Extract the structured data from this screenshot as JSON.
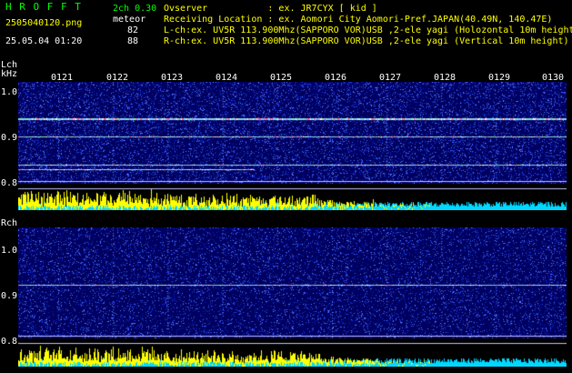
{
  "header": {
    "logo": "H R O F F T",
    "mode": "2ch 0.30",
    "type": "meteor",
    "filename": "2505040120.png",
    "datetime": "25.05.04 01:20",
    "count_l": "82",
    "count_r": "88",
    "observer": "Ovserver           : ex. JR7CYX [ kid ]",
    "location": "Receiving Location : ex. Aomori City Aomori-Pref.JAPAN(40.49N, 140.47E)",
    "lch_info": "L-ch:ex. UV5R 113.900Mhz(SAPPORO VOR)USB ,2-ele yagi (Holozontal 10m height)",
    "rch_info": "R-ch:ex. UV5R 113.900Mhz(SAPPORO VOR)USB ,2-ele yagi (Vertical 10m height)"
  },
  "time_ticks": [
    "0121",
    "0122",
    "0123",
    "0124",
    "0125",
    "0126",
    "0127",
    "0128",
    "0129",
    "0130"
  ],
  "lch": {
    "label": "Lch",
    "unit": "kHz",
    "freq_ticks": [
      "1.0",
      "0.9",
      "0.8"
    ]
  },
  "rch": {
    "label": "Rch",
    "freq_ticks": [
      "1.0",
      "0.9",
      "0.8"
    ]
  },
  "colors": {
    "header_green": "#00ff00",
    "text_white": "#ffffff",
    "activity_yellow": "#ffff00",
    "activity_cyan": "#00e5ff",
    "noise_bg": "#00006a"
  }
}
